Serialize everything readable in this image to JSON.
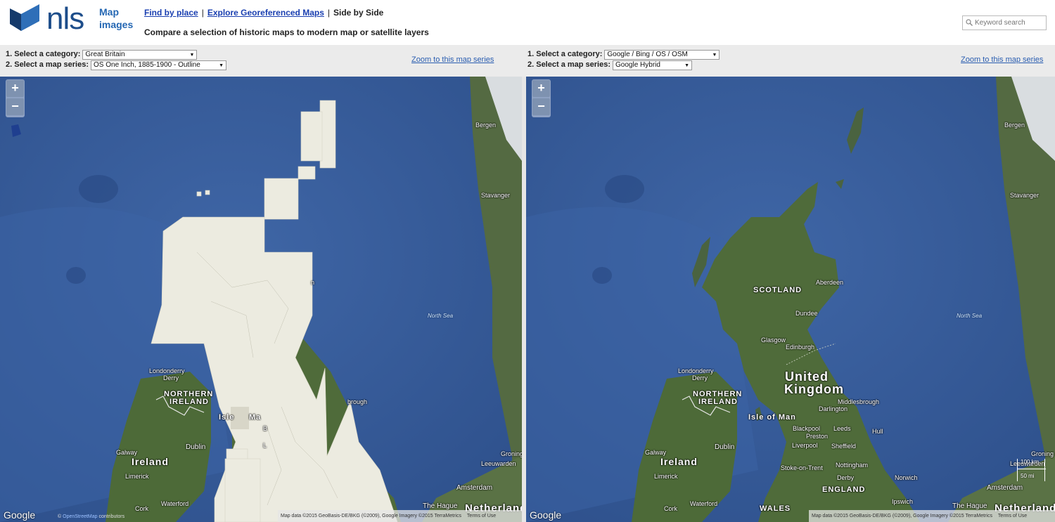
{
  "header": {
    "logo_text": "nls",
    "brand_line1": "Map",
    "brand_line2": "images",
    "nav": {
      "find_by_place": "Find by place",
      "explore": "Explore Georeferenced Maps",
      "current": "Side by Side",
      "separator": "|"
    },
    "subtitle": "Compare a selection of historic maps to modern map or satellite layers",
    "search": {
      "placeholder": "Keyword search",
      "icon": "search-icon"
    }
  },
  "left_controls": {
    "category_label": "1.  Select a category:",
    "category_value": "Great Britain",
    "series_label": "2.  Select a map series:",
    "series_value": "OS One Inch, 1885-1900 - Outline",
    "zoom_link": "Zoom to this map series"
  },
  "right_controls": {
    "category_label": "1.  Select a category:",
    "category_value": "Google / Bing / OS / OSM",
    "series_label": "2.  Select a map series:",
    "series_value": "Google Hybrid",
    "zoom_link": "Zoom to this map series"
  },
  "zoom": {
    "in": "+",
    "out": "−"
  },
  "labels": {
    "bergen": "Bergen",
    "stavanger": "Stavanger",
    "north_sea": "North Sea",
    "scotland": "SCOTLAND",
    "aberdeen": "Aberdeen",
    "dundee": "Dundee",
    "glasgow": "Glasgow",
    "edinburgh": "Edinburgh",
    "londonderry": "Londonderry",
    "derry": "Derry",
    "northern": "NORTHERN",
    "ireland_caps": "IRELAND",
    "isle_of_man": "Isle of Man",
    "isle_of_man_partial": "Isle",
    "isle_of_man_partial2": "Ma",
    "united": "United",
    "kingdom": "Kingdom",
    "darlington": "Darlington",
    "middlesbrough": "Middlesbrough",
    "middlesbrough_partial": "brough",
    "blackpool": "Blackpool",
    "leeds": "Leeds",
    "preston": "Preston",
    "hull": "Hull",
    "liverpool": "Liverpool",
    "sheffield": "Sheffield",
    "galway": "Galway",
    "dublin": "Dublin",
    "ireland": "Ireland",
    "limerick": "Limerick",
    "cork": "Cork",
    "waterford": "Waterford",
    "stoke": "Stoke-on-Trent",
    "nottingham": "Nottingham",
    "derby": "Derby",
    "norwich": "Norwich",
    "england": "ENGLAND",
    "wales": "WALES",
    "ipswich": "Ipswich",
    "amsterdam": "Amsterdam",
    "the_hague": "The Hague",
    "netherlands": "Netherland",
    "groningen": "Groning",
    "leeuwarden": "Leeuwarden",
    "partial_b": "B",
    "partial_l": "L",
    "partial_n": "n"
  },
  "footer": {
    "google": "Google",
    "osm_prefix": "©",
    "osm_link": "OpenStreetMap",
    "osm_suffix": "contributors",
    "attribution": "Map data ©2015 GeoBasis-DE/BKG (©2009), Google Imagery ©2015 TerraMetrics",
    "terms": "Terms of Use",
    "scale_km": "100 km",
    "scale_mi": "50 mi"
  },
  "colors": {
    "sea": "#3a5f9c",
    "land": "#4f6b3a",
    "historic_sheet": "#ecebe0",
    "link": "#1a3fb0"
  }
}
